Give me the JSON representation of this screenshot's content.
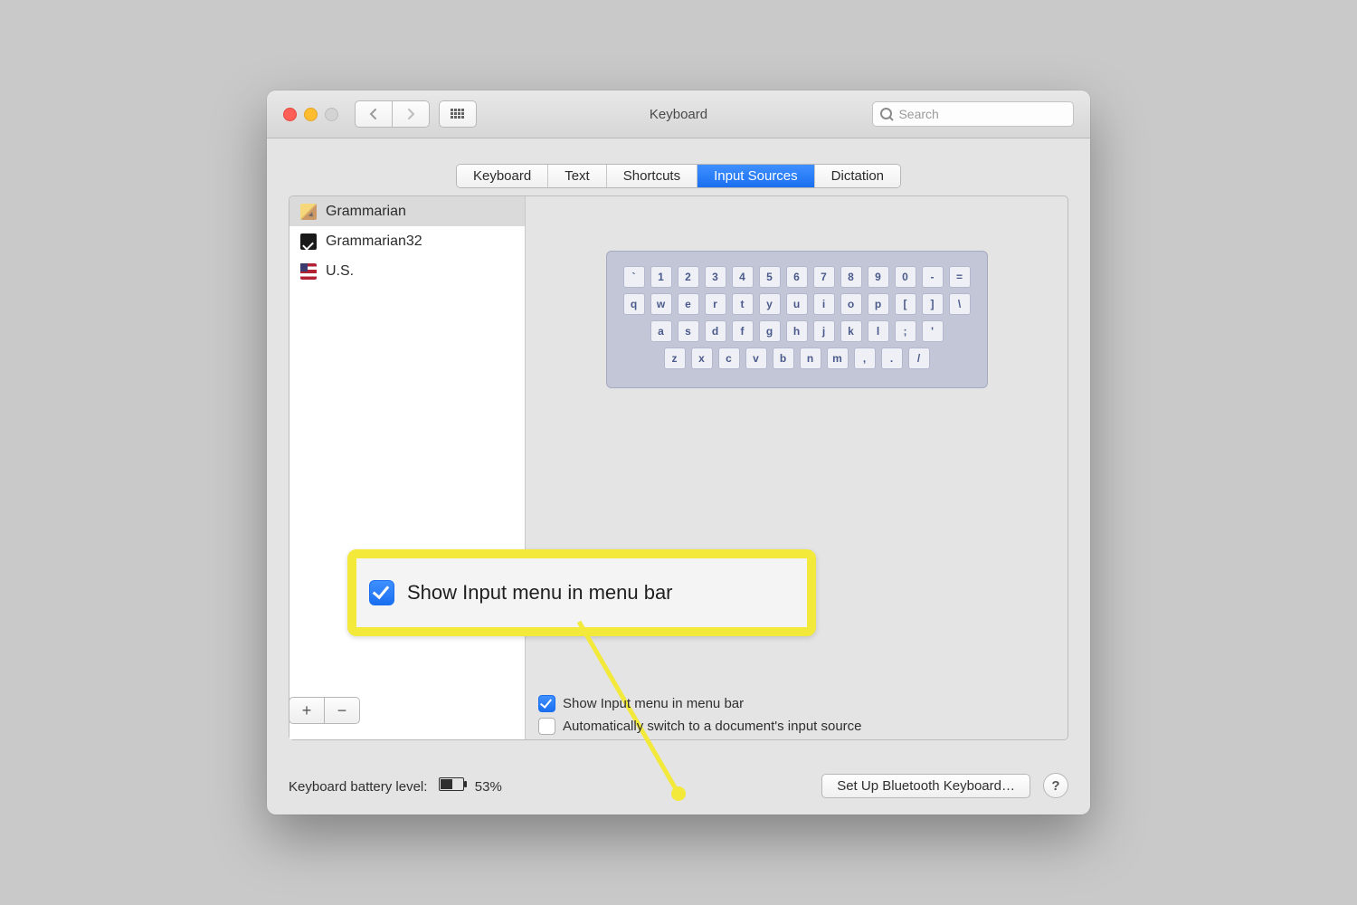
{
  "window": {
    "title": "Keyboard"
  },
  "search": {
    "placeholder": "Search"
  },
  "tabs": [
    {
      "label": "Keyboard",
      "selected": false
    },
    {
      "label": "Text",
      "selected": false
    },
    {
      "label": "Shortcuts",
      "selected": false
    },
    {
      "label": "Input Sources",
      "selected": true
    },
    {
      "label": "Dictation",
      "selected": false
    }
  ],
  "sources": [
    {
      "label": "Grammarian",
      "icon": "pencil",
      "selected": true
    },
    {
      "label": "Grammarian32",
      "icon": "dark",
      "selected": false
    },
    {
      "label": "U.S.",
      "icon": "us",
      "selected": false
    }
  ],
  "keyboard_rows": [
    [
      "`",
      "1",
      "2",
      "3",
      "4",
      "5",
      "6",
      "7",
      "8",
      "9",
      "0",
      "-",
      "="
    ],
    [
      "q",
      "w",
      "e",
      "r",
      "t",
      "y",
      "u",
      "i",
      "o",
      "p",
      "[",
      "]",
      "\\"
    ],
    [
      "a",
      "s",
      "d",
      "f",
      "g",
      "h",
      "j",
      "k",
      "l",
      ";",
      "'"
    ],
    [
      "z",
      "x",
      "c",
      "v",
      "b",
      "n",
      "m",
      ",",
      ".",
      "/"
    ]
  ],
  "checks": {
    "show_input_menu": {
      "label": "Show Input menu in menu bar",
      "checked": true
    },
    "auto_switch": {
      "label": "Automatically switch to a document's input source",
      "checked": false
    }
  },
  "highlight": {
    "label": "Show Input menu in menu bar",
    "checked": true
  },
  "footer": {
    "battery_label": "Keyboard battery level:",
    "battery_pct": "53%",
    "bluetooth_btn": "Set Up Bluetooth Keyboard…"
  }
}
